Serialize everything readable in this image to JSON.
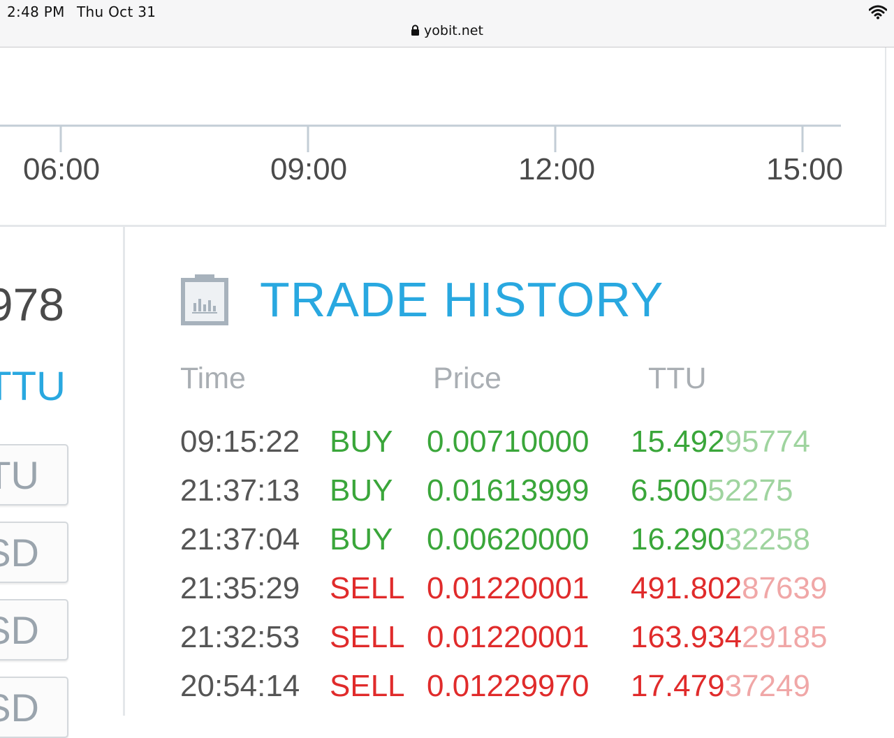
{
  "status_bar": {
    "time": "2:48 PM",
    "date": "Thu Oct 31",
    "url": "yobit.net",
    "icons": [
      "lock-icon",
      "wifi-icon"
    ]
  },
  "chart": {
    "x_ticks": [
      "06:00",
      "09:00",
      "12:00",
      "15:00"
    ]
  },
  "left_panel": {
    "value_fragment": "978",
    "currency_fragment": "TTU",
    "buttons": [
      "TU",
      "SD",
      "SD",
      "SD"
    ]
  },
  "trade_history": {
    "title": "TRADE HISTORY",
    "icon": "chart-clipboard-icon",
    "columns": [
      "Time",
      "Price",
      "TTU"
    ],
    "rows": [
      {
        "time": "09:15:22",
        "type": "BUY",
        "price": "0.00710000",
        "amount_main": "15.492",
        "amount_dim": "95774"
      },
      {
        "time": "21:37:13",
        "type": "BUY",
        "price": "0.01613999",
        "amount_main": "6.500",
        "amount_dim": "52275"
      },
      {
        "time": "21:37:04",
        "type": "BUY",
        "price": "0.00620000",
        "amount_main": "16.290",
        "amount_dim": "32258"
      },
      {
        "time": "21:35:29",
        "type": "SELL",
        "price": "0.01220001",
        "amount_main": "491.802",
        "amount_dim": "87639"
      },
      {
        "time": "21:32:53",
        "type": "SELL",
        "price": "0.01220001",
        "amount_main": "163.934",
        "amount_dim": "29185"
      },
      {
        "time": "20:54:14",
        "type": "SELL",
        "price": "0.01229970",
        "amount_main": "17.479",
        "amount_dim": "37249"
      }
    ]
  },
  "colors": {
    "accent": "#29a8e0",
    "buy": "#3aa63a",
    "sell": "#e02b2b"
  }
}
